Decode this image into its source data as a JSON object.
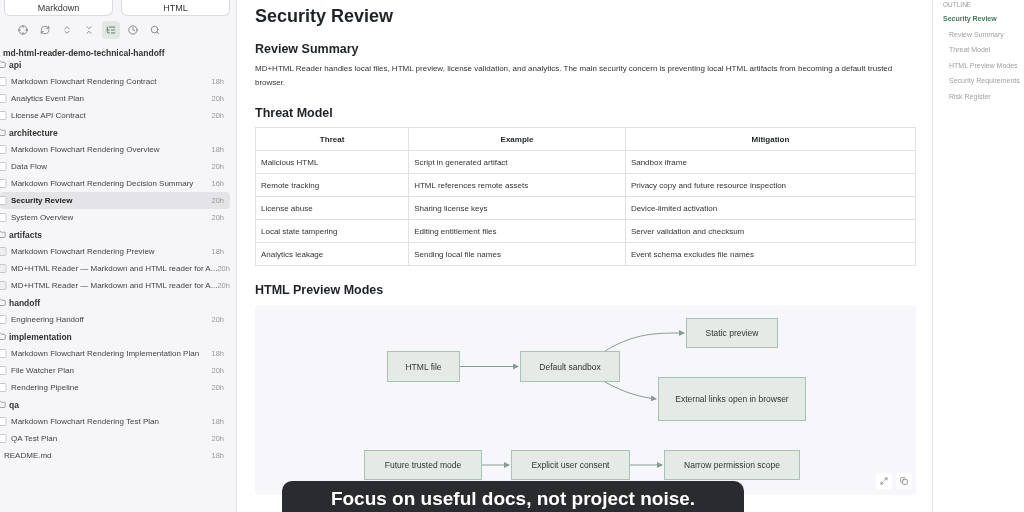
{
  "view_buttons": [
    {
      "label": "Markdown",
      "selected": false
    },
    {
      "label": "HTML",
      "selected": false
    }
  ],
  "toolbar": [
    {
      "kind": "locate",
      "selected": false
    },
    {
      "kind": "refresh",
      "selected": false
    },
    {
      "kind": "expand",
      "selected": false
    },
    {
      "kind": "collapse",
      "selected": false
    },
    {
      "kind": "tree",
      "selected": true
    },
    {
      "kind": "recent",
      "selected": false
    },
    {
      "kind": "search",
      "selected": false
    }
  ],
  "tree": {
    "root": "md-html-reader-demo-technical-handoff",
    "items": [
      {
        "kind": "folder",
        "label": "api",
        "children": [
          {
            "kind": "doc",
            "label": "Markdown Flowchart Rendering Contract",
            "age": "18h",
            "selected": false
          },
          {
            "kind": "doc",
            "label": "Analytics Event Plan",
            "age": "20h",
            "selected": false
          },
          {
            "kind": "doc",
            "label": "License API Contract",
            "age": "20h",
            "selected": false
          }
        ]
      },
      {
        "kind": "folder",
        "label": "architecture",
        "children": [
          {
            "kind": "doc",
            "label": "Markdown Flowchart Rendering Overview",
            "age": "18h",
            "selected": false
          },
          {
            "kind": "doc",
            "label": "Data Flow",
            "age": "20h",
            "selected": false
          },
          {
            "kind": "doc",
            "label": "Markdown Flowchart Rendering Decision Summary",
            "age": "16h",
            "selected": false
          },
          {
            "kind": "doc",
            "label": "Security Review",
            "age": "20h",
            "selected": true
          },
          {
            "kind": "doc",
            "label": "System Overview",
            "age": "20h",
            "selected": false
          }
        ]
      },
      {
        "kind": "folder",
        "label": "artifacts",
        "children": [
          {
            "kind": "html",
            "label": "Markdown Flowchart Rendering Preview",
            "age": "18h",
            "selected": false
          },
          {
            "kind": "html",
            "label": "MD+HTML Reader — Markdown and HTML reader for A...",
            "age": "20h",
            "selected": false
          },
          {
            "kind": "html",
            "label": "MD+HTML Reader — Markdown and HTML reader for A...",
            "age": "20h",
            "selected": false
          }
        ]
      },
      {
        "kind": "folder",
        "label": "handoff",
        "children": [
          {
            "kind": "doc",
            "label": "Engineering Handoff",
            "age": "20h",
            "selected": false
          }
        ]
      },
      {
        "kind": "folder",
        "label": "implementation",
        "children": [
          {
            "kind": "doc",
            "label": "Markdown Flowchart Rendering Implementation Plan",
            "age": "18h",
            "selected": false
          },
          {
            "kind": "doc",
            "label": "File Watcher Plan",
            "age": "20h",
            "selected": false
          },
          {
            "kind": "doc",
            "label": "Rendering Pipeline",
            "age": "20h",
            "selected": false
          }
        ]
      },
      {
        "kind": "folder",
        "label": "qa",
        "children": [
          {
            "kind": "doc",
            "label": "Markdown Flowchart Rendering Test Plan",
            "age": "18h",
            "selected": false
          },
          {
            "kind": "doc",
            "label": "QA Test Plan",
            "age": "20h",
            "selected": false
          }
        ]
      },
      {
        "kind": "file",
        "label": "README.md",
        "age": "18h",
        "selected": false
      }
    ]
  },
  "document": {
    "title": "Security Review",
    "summary_heading": "Review Summary",
    "summary": "MD+HTML Reader handles local files, HTML preview, license validation, and analytics. The main security concern is preventing local HTML artifacts from becoming a default trusted browser.",
    "threat_heading": "Threat Model",
    "table": {
      "columns": [
        "Threat",
        "Example",
        "Mitigation"
      ],
      "rows": [
        [
          "Malicious HTML",
          "Script in generated artifact",
          "Sandbox iframe"
        ],
        [
          "Remote tracking",
          "HTML references remote assets",
          "Privacy copy and future resource inspection"
        ],
        [
          "License abuse",
          "Sharing license keys",
          "Device-limited activation"
        ],
        [
          "Local state tampering",
          "Editing entitlement files",
          "Server validation and checksum"
        ],
        [
          "Analytics leakage",
          "Sending local file names",
          "Event schema excludes file names"
        ]
      ]
    },
    "preview_heading": "HTML Preview Modes",
    "diagram": {
      "nodes": [
        "HTML file",
        "Default sandbox",
        "Static preview",
        "External links open in browser",
        "Future trusted mode",
        "Explicit user consent",
        "Narrow permission scope"
      ]
    }
  },
  "outline": {
    "heading": "OUTLINE",
    "items": [
      {
        "label": "Security Review",
        "selected": true,
        "children": [
          {
            "label": "Review Summary",
            "selected": false
          },
          {
            "label": "Threat Model",
            "selected": false
          },
          {
            "label": "HTML Preview Modes",
            "selected": false
          },
          {
            "label": "Security Requirements",
            "selected": false
          },
          {
            "label": "Risk Register",
            "selected": false
          }
        ]
      }
    ]
  },
  "caption": "Focus on useful docs, not project noise."
}
